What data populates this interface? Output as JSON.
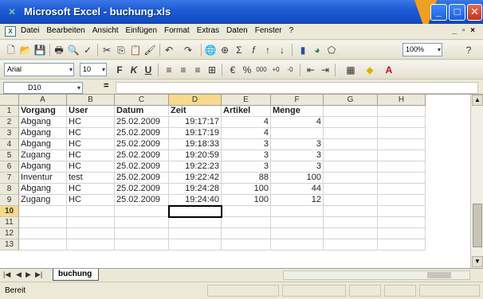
{
  "window": {
    "title": "Microsoft Excel - buchung.xls",
    "minimize_label": "_",
    "maximize_label": "□",
    "close_label": "✕"
  },
  "menu": {
    "items": [
      "Datei",
      "Bearbeiten",
      "Ansicht",
      "Einfügen",
      "Format",
      "Extras",
      "Daten",
      "Fenster",
      "?"
    ],
    "doc_controls": "_ ▫ ×"
  },
  "toolbar": {
    "zoom": "100%",
    "font_name": "Arial",
    "font_size": "10"
  },
  "formula_bar": {
    "name_box": "D10",
    "equals_label": "="
  },
  "grid": {
    "columns": [
      "A",
      "B",
      "C",
      "D",
      "E",
      "F",
      "G",
      "H"
    ],
    "active_column": "D",
    "row_numbers": [
      "1",
      "2",
      "3",
      "4",
      "5",
      "6",
      "7",
      "8",
      "9",
      "10",
      "11",
      "12",
      "13"
    ],
    "active_row": "10",
    "header_row": [
      "Vorgang",
      "User",
      "Datum",
      "Zeit",
      "Artikel",
      "Menge"
    ],
    "rows": [
      [
        "Abgang",
        "HC",
        "25.02.2009",
        "19:17:17",
        "4",
        "4"
      ],
      [
        "Abgang",
        "HC",
        "25.02.2009",
        "19:17:19",
        "4",
        ""
      ],
      [
        "Abgang",
        "HC",
        "25.02.2009",
        "19:18:33",
        "3",
        "3"
      ],
      [
        "Zugang",
        "HC",
        "25.02.2009",
        "19:20:59",
        "3",
        "3"
      ],
      [
        "Abgang",
        "HC",
        "25.02.2009",
        "19:22:23",
        "3",
        "3"
      ],
      [
        "Inventur",
        "test",
        "25.02.2009",
        "19:22:42",
        "88",
        "100"
      ],
      [
        "Abgang",
        "HC",
        "25.02.2009",
        "19:24:28",
        "100",
        "44"
      ],
      [
        "Zugang",
        "HC",
        "25.02.2009",
        "19:24:40",
        "100",
        "12"
      ]
    ]
  },
  "sheet_tabs": {
    "active": "buchung"
  },
  "status": {
    "text": "Bereit"
  },
  "colors": {
    "titlebar": "#1d5bd6",
    "active_header": "#f9d98a"
  }
}
